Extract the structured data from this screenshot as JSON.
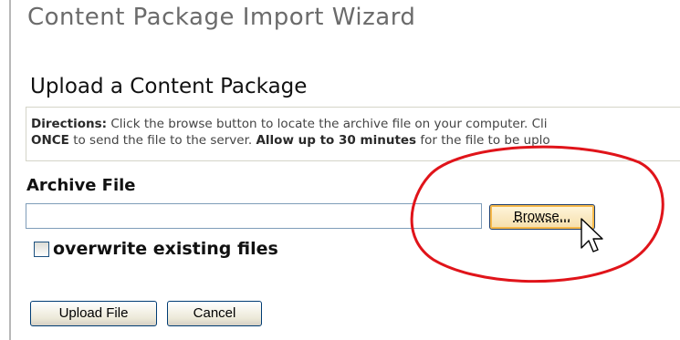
{
  "wizard": {
    "title": "Content Package Import Wizard"
  },
  "section": {
    "title": "Upload a Content Package"
  },
  "directions": {
    "label": "Directions:",
    "line1_text": "Click the browse button to locate the archive file on your computer. Cli",
    "line2_strong1": "ONCE",
    "line2_text1": "to send the file to the server.",
    "line2_strong2": "Allow up to 30 minutes",
    "line2_text2": "for the file to be uplo"
  },
  "archive": {
    "label": "Archive File",
    "file_value": "",
    "browse_label": "Browse..."
  },
  "options": {
    "overwrite_label": "overwrite existing files",
    "overwrite_checked": false
  },
  "actions": {
    "upload_label": "Upload File",
    "cancel_label": "Cancel"
  },
  "annotation": {
    "highlight_color": "#e0141a",
    "target": "browse-button"
  },
  "icons": {
    "cursor": "mouse-pointer-icon"
  }
}
